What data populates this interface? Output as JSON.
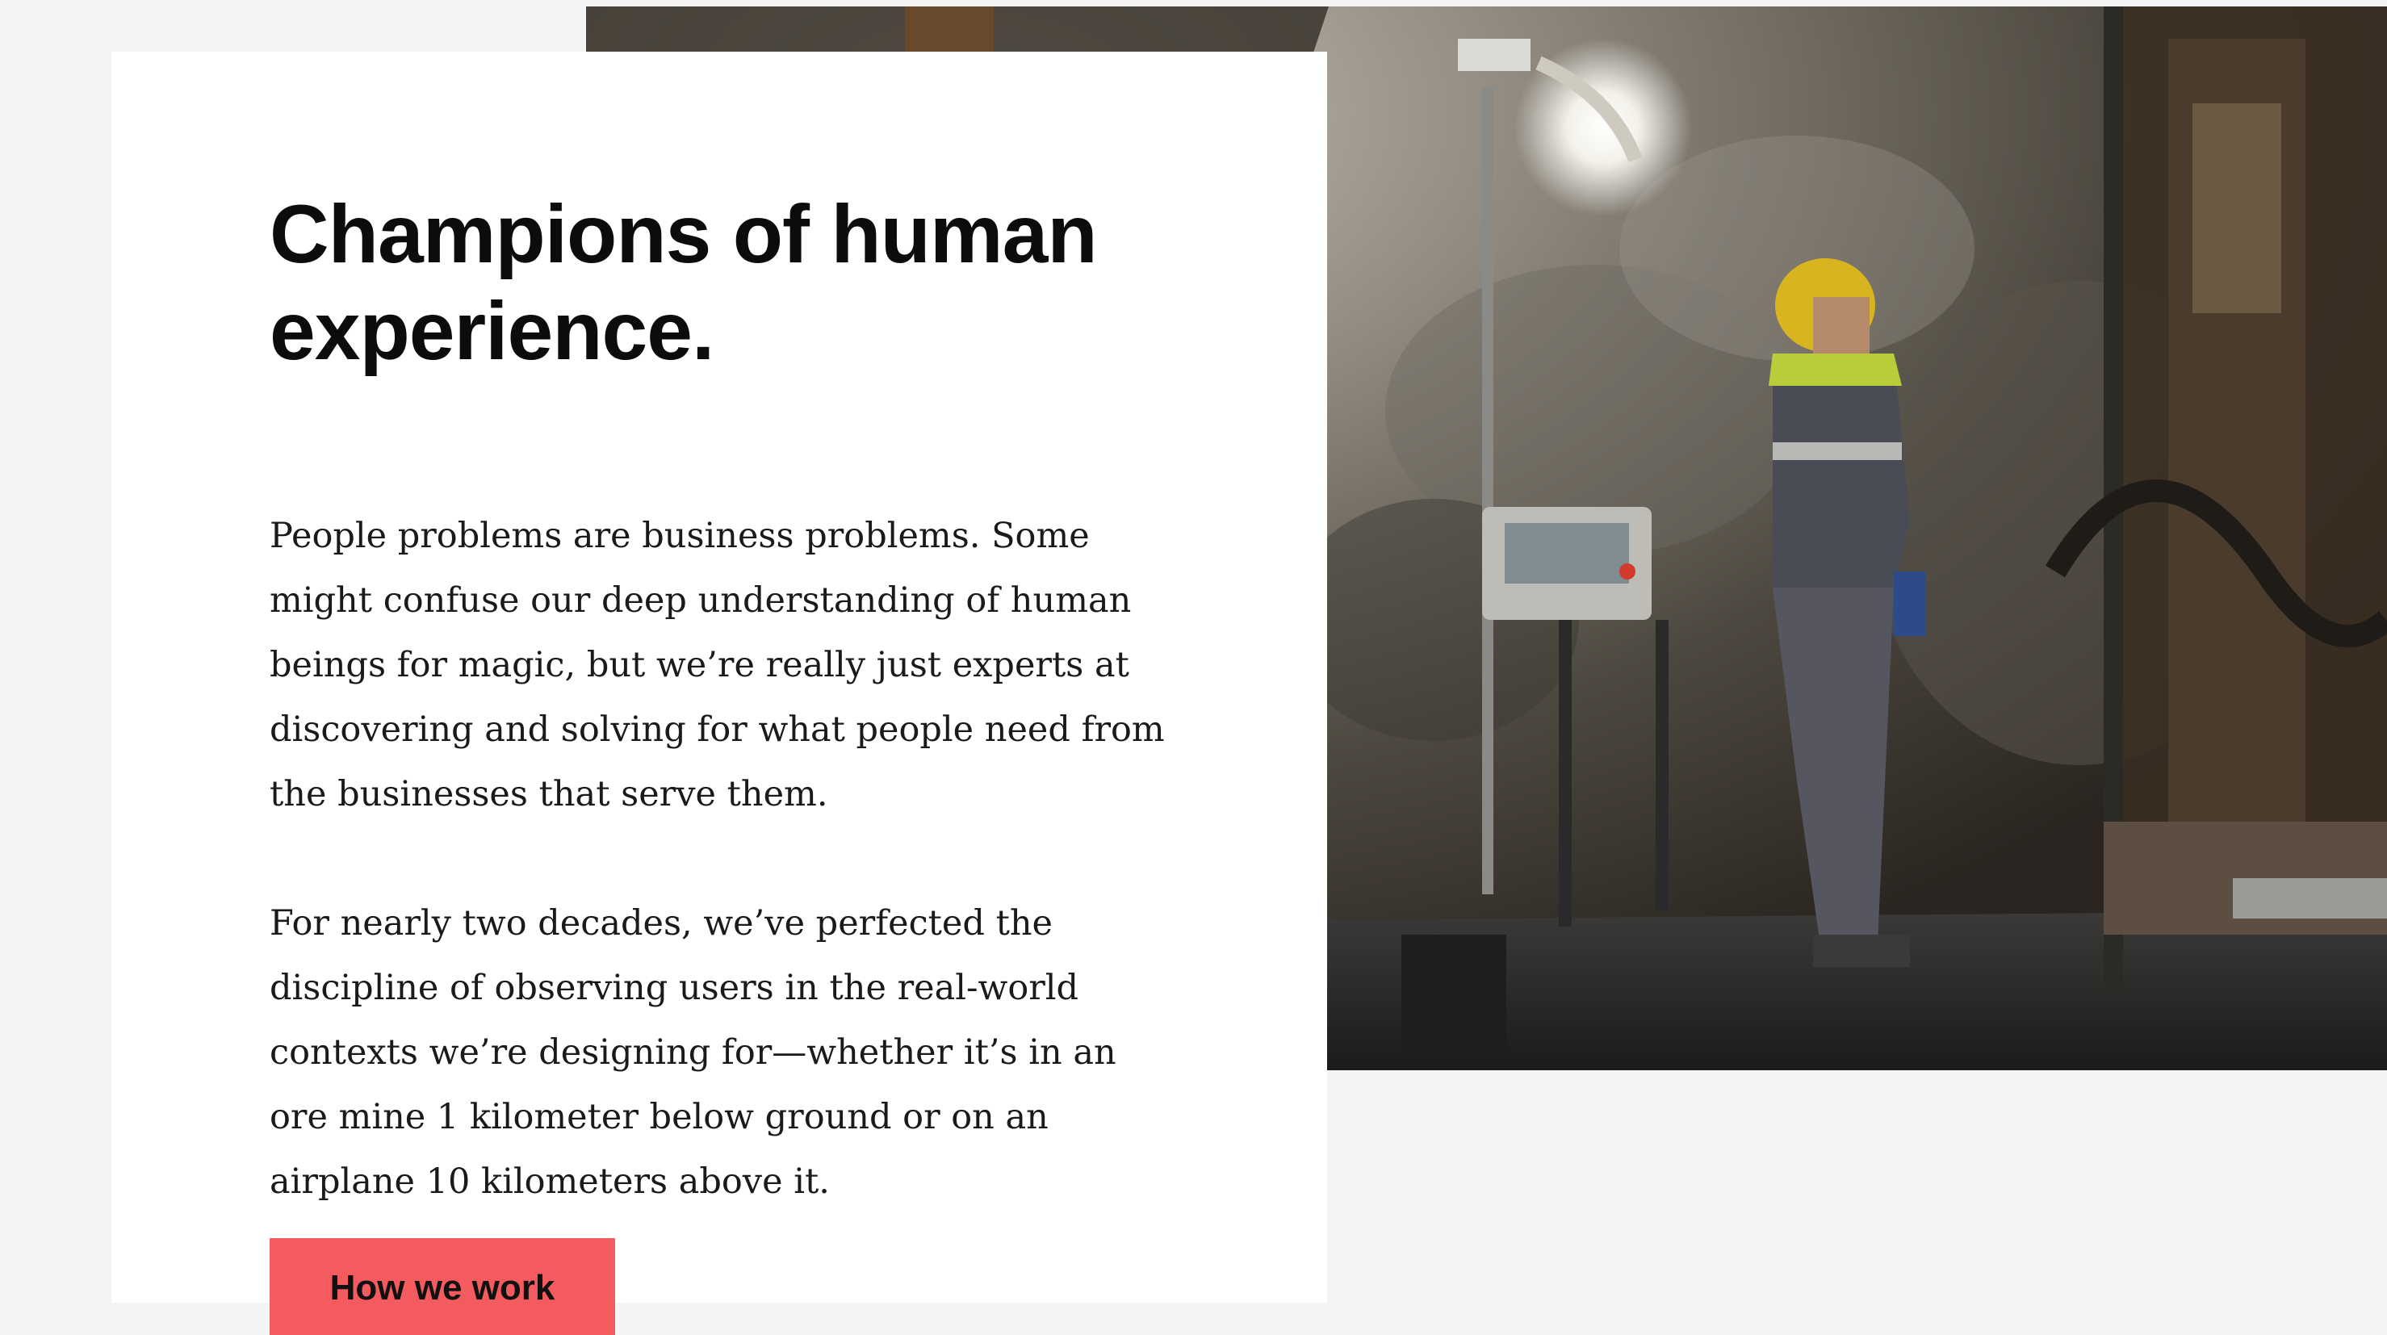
{
  "hero": {
    "headline": "Champions of human experience.",
    "paragraphs": [
      "People problems are business problems. Some might confuse our deep understanding of human beings for magic, but we’re really just experts at discovering and solving for what people need from the businesses that serve them.",
      "For nearly two decades, we’ve perfected the discipline of observing users in the real-world contexts we’re designing for—whether it’s in an ore mine 1 kilometer below ground or on an airplane 10 kilometers above it."
    ],
    "cta_label": "How we work"
  },
  "photo": {
    "subject": "miner-in-underground-mine-photo"
  },
  "colors": {
    "page_background": "#f4f4f6",
    "card_background": "#ffffff",
    "accent": "#f45b5e",
    "text": "#1a1a1a"
  }
}
